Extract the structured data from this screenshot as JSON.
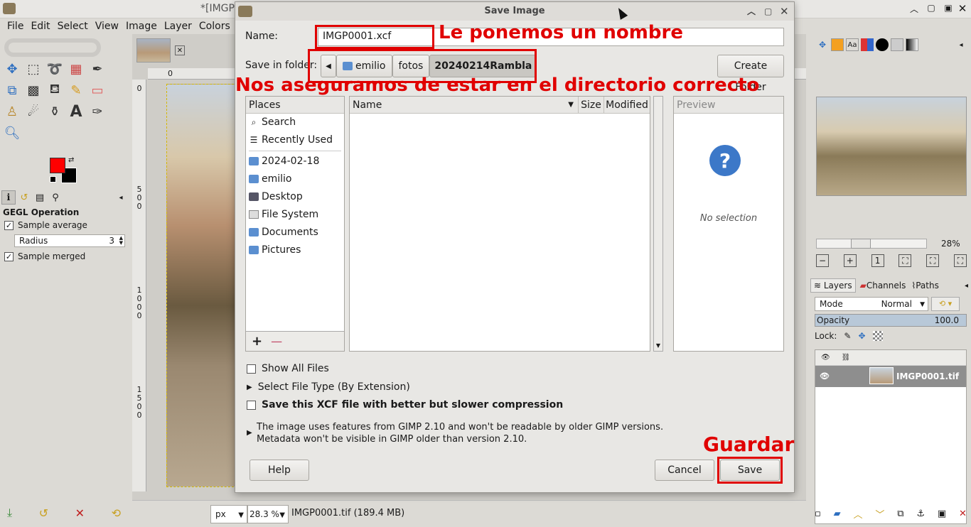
{
  "main_window": {
    "title": "*[IMGP",
    "menus": [
      "File",
      "Edit",
      "Select",
      "View",
      "Image",
      "Layer",
      "Colors"
    ]
  },
  "toolbox": {
    "tools": [
      "move-tool",
      "rect-select-tool",
      "lasso-tool",
      "fuzzy-select-tool",
      "paths-tool",
      "crop-tool",
      "unified-transform-tool",
      "warp-tool",
      "paintbrush-tool",
      "eraser-tool",
      "clone-tool",
      "smudge-tool",
      "text-tool",
      "color-picker-tool",
      "zoom-tool"
    ],
    "fg_color": "#ff0000",
    "bg_color": "#000000",
    "options_title": "GEGL Operation",
    "sample_average": "Sample average",
    "radius_label": "Radius",
    "radius_value": "3",
    "sample_merged": "Sample merged"
  },
  "canvas": {
    "ruler_h": "0",
    "ruler_v": [
      "0",
      "5",
      "0",
      "0",
      "1",
      "0",
      "0",
      "0",
      "1",
      "5",
      "0",
      "0"
    ],
    "unit": "px",
    "zoom": "28.3 %",
    "status": "IMGP0001.tif (189.4 MB)"
  },
  "dialog": {
    "title": "Save Image",
    "name_label": "Name:",
    "name_value": "IMGP0001.xcf",
    "folder_label": "Save in folder:",
    "path": [
      "emilio",
      "fotos",
      "20240214Rambla"
    ],
    "create_folder": "Create Folder",
    "places_header": "Places",
    "places": [
      {
        "label": "Search",
        "icon": "search-icon"
      },
      {
        "label": "Recently Used",
        "icon": "recent-icon"
      },
      {
        "label": "2024-02-18",
        "icon": "folder-icon"
      },
      {
        "label": "emilio",
        "icon": "home-folder-icon"
      },
      {
        "label": "Desktop",
        "icon": "desktop-icon"
      },
      {
        "label": "File System",
        "icon": "drive-icon"
      },
      {
        "label": "Documents",
        "icon": "folder-icon"
      },
      {
        "label": "Pictures",
        "icon": "folder-icon"
      }
    ],
    "columns": {
      "name": "Name",
      "size": "Size",
      "modified": "Modified"
    },
    "preview_header": "Preview",
    "preview_empty": "No selection",
    "show_all": "Show All Files",
    "file_type": "Select File Type (By Extension)",
    "compress_label": "Save this XCF file with better but slower compression",
    "info_line1": "The image uses features from GIMP 2.10 and won't be readable by older GIMP versions.",
    "info_line2": "Metadata won't be visible in GIMP older than version 2.10.",
    "help": "Help",
    "cancel": "Cancel",
    "save": "Save"
  },
  "annotations": {
    "name": "Le ponemos un nombre",
    "folder": "Nos aseguramos de estar en el directorio correcto",
    "save": "Guardar",
    "color": "#e00000"
  },
  "right_dock": {
    "nav_zoom": "28%",
    "tabs": [
      "Layers",
      "Channels",
      "Paths"
    ],
    "mode_label": "Mode",
    "mode_value": "Normal",
    "opacity_label": "Opacity",
    "opacity_value": "100.0",
    "lock_label": "Lock:",
    "layer_name": "IMGP0001.tif"
  }
}
